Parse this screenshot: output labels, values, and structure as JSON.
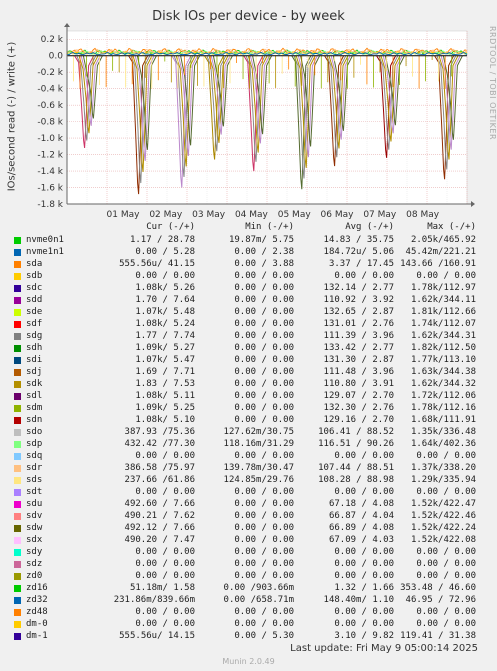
{
  "chart_data": {
    "type": "line",
    "title": "Disk IOs per device - by week",
    "ylabel": "IOs/second read (-) / write (+)",
    "ylim": [
      -1.8,
      0.3
    ],
    "yticks": [
      0.2,
      0.0,
      -0.2,
      -0.4,
      -0.6,
      -0.8,
      -1.0,
      -1.2,
      -1.4,
      -1.6,
      -1.8
    ],
    "ytick_labels": [
      "0.2 k",
      "0.0",
      "-0.2 k",
      "-0.4 k",
      "-0.6 k",
      "-0.8 k",
      "-1.0 k",
      "-1.2 k",
      "-1.4 k",
      "-1.6 k",
      "-1.8 k"
    ],
    "xticks": [
      "01 May",
      "02 May",
      "03 May",
      "04 May",
      "05 May",
      "06 May",
      "07 May",
      "08 May"
    ],
    "grid": true,
    "read_dips": [
      {
        "day": 0.55,
        "depth": -1.12,
        "color": "#cc3366"
      },
      {
        "day": 1.9,
        "depth": -1.68,
        "color": "#8f2c00"
      },
      {
        "day": 2.98,
        "depth": -1.6,
        "color": "#bb88cc"
      },
      {
        "day": 3.8,
        "depth": -1.26,
        "color": "#aa8800"
      },
      {
        "day": 4.78,
        "depth": -1.4,
        "color": "#cc3366"
      },
      {
        "day": 5.98,
        "depth": -1.62,
        "color": "#556b2f"
      },
      {
        "day": 6.8,
        "depth": -1.34,
        "color": "#8f2c00"
      },
      {
        "day": 8.1,
        "depth": -1.24,
        "color": "#990000"
      },
      {
        "day": 9.55,
        "depth": -1.5,
        "color": "#8f2c00"
      }
    ]
  },
  "columns": {
    "cur": "Cur (-/+)",
    "min": "Min (-/+)",
    "avg": "Avg (-/+)",
    "max": "Max (-/+)"
  },
  "legend": [
    {
      "name": "nvme0n1",
      "color": "#00cc00",
      "cur": "1.17 / 28.78",
      "min": "19.87m/ 5.75",
      "avg": "14.83 / 35.75",
      "max": "2.05k/465.92"
    },
    {
      "name": "nvme1n1",
      "color": "#0066b3",
      "cur": "0.00 / 5.28",
      "min": "0.00 / 2.38",
      "avg": "184.72u/ 5.06",
      "max": "45.42m/221.21"
    },
    {
      "name": "sda",
      "color": "#ff8000",
      "cur": "555.56u/ 41.15",
      "min": "0.00 / 3.88",
      "avg": "3.37 / 17.45",
      "max": "143.66 /160.91"
    },
    {
      "name": "sdb",
      "color": "#ffcc00",
      "cur": "0.00 / 0.00",
      "min": "0.00 / 0.00",
      "avg": "0.00 / 0.00",
      "max": "0.00 / 0.00"
    },
    {
      "name": "sdc",
      "color": "#330099",
      "cur": "1.08k/ 5.26",
      "min": "0.00 / 0.00",
      "avg": "132.14 / 2.77",
      "max": "1.78k/112.97"
    },
    {
      "name": "sdd",
      "color": "#990099",
      "cur": "1.70 / 7.64",
      "min": "0.00 / 0.00",
      "avg": "110.92 / 3.92",
      "max": "1.62k/344.11"
    },
    {
      "name": "sde",
      "color": "#ccff00",
      "cur": "1.07k/ 5.48",
      "min": "0.00 / 0.00",
      "avg": "132.65 / 2.87",
      "max": "1.81k/112.66"
    },
    {
      "name": "sdf",
      "color": "#ff0000",
      "cur": "1.08k/ 5.24",
      "min": "0.00 / 0.00",
      "avg": "131.01 / 2.76",
      "max": "1.74k/112.07"
    },
    {
      "name": "sdg",
      "color": "#808080",
      "cur": "1.77 / 7.74",
      "min": "0.00 / 0.00",
      "avg": "111.39 / 3.96",
      "max": "1.62k/344.31"
    },
    {
      "name": "sdh",
      "color": "#008f00",
      "cur": "1.09k/ 5.27",
      "min": "0.00 / 0.00",
      "avg": "133.42 / 2.77",
      "max": "1.82k/112.50"
    },
    {
      "name": "sdi",
      "color": "#00487d",
      "cur": "1.07k/ 5.47",
      "min": "0.00 / 0.00",
      "avg": "131.30 / 2.87",
      "max": "1.77k/113.10"
    },
    {
      "name": "sdj",
      "color": "#b35a00",
      "cur": "1.69 / 7.71",
      "min": "0.00 / 0.00",
      "avg": "111.48 / 3.96",
      "max": "1.63k/344.38"
    },
    {
      "name": "sdk",
      "color": "#b38f00",
      "cur": "1.83 / 7.53",
      "min": "0.00 / 0.00",
      "avg": "110.80 / 3.91",
      "max": "1.62k/344.32"
    },
    {
      "name": "sdl",
      "color": "#6b006b",
      "cur": "1.08k/ 5.11",
      "min": "0.00 / 0.00",
      "avg": "129.07 / 2.70",
      "max": "1.72k/112.06"
    },
    {
      "name": "sdm",
      "color": "#8fb300",
      "cur": "1.09k/ 5.25",
      "min": "0.00 / 0.00",
      "avg": "132.30 / 2.76",
      "max": "1.78k/112.16"
    },
    {
      "name": "sdn",
      "color": "#b30000",
      "cur": "1.08k/ 5.10",
      "min": "0.00 / 0.00",
      "avg": "129.16 / 2.70",
      "max": "1.68k/111.91"
    },
    {
      "name": "sdo",
      "color": "#bebebe",
      "cur": "387.93 /75.36",
      "min": "127.62m/30.75",
      "avg": "106.41 / 88.52",
      "max": "1.35k/336.48"
    },
    {
      "name": "sdp",
      "color": "#80ff80",
      "cur": "432.42 /77.30",
      "min": "118.16m/31.29",
      "avg": "116.51 / 90.26",
      "max": "1.64k/402.36"
    },
    {
      "name": "sdq",
      "color": "#80c9ff",
      "cur": "0.00 / 0.00",
      "min": "0.00 / 0.00",
      "avg": "0.00 / 0.00",
      "max": "0.00 / 0.00"
    },
    {
      "name": "sdr",
      "color": "#ffc080",
      "cur": "386.58 /75.97",
      "min": "139.78m/30.47",
      "avg": "107.44 / 88.51",
      "max": "1.37k/338.20"
    },
    {
      "name": "sds",
      "color": "#ffe680",
      "cur": "237.66 /61.86",
      "min": "124.85m/29.76",
      "avg": "108.28 / 88.98",
      "max": "1.29k/335.94"
    },
    {
      "name": "sdt",
      "color": "#aa80ff",
      "cur": "0.00 / 0.00",
      "min": "0.00 / 0.00",
      "avg": "0.00 / 0.00",
      "max": "0.00 / 0.00"
    },
    {
      "name": "sdu",
      "color": "#ee00cc",
      "cur": "492.60 / 7.66",
      "min": "0.00 / 0.00",
      "avg": "67.18 / 4.08",
      "max": "1.52k/422.47"
    },
    {
      "name": "sdv",
      "color": "#ff8080",
      "cur": "490.21 / 7.62",
      "min": "0.00 / 0.00",
      "avg": "66.87 / 4.04",
      "max": "1.52k/422.46"
    },
    {
      "name": "sdw",
      "color": "#666600",
      "cur": "492.12 / 7.66",
      "min": "0.00 / 0.00",
      "avg": "66.89 / 4.08",
      "max": "1.52k/422.24"
    },
    {
      "name": "sdx",
      "color": "#ffbfff",
      "cur": "490.20 / 7.47",
      "min": "0.00 / 0.00",
      "avg": "67.09 / 4.03",
      "max": "1.52k/422.08"
    },
    {
      "name": "sdy",
      "color": "#00ffcc",
      "cur": "0.00 / 0.00",
      "min": "0.00 / 0.00",
      "avg": "0.00 / 0.00",
      "max": "0.00 / 0.00"
    },
    {
      "name": "sdz",
      "color": "#cc6699",
      "cur": "0.00 / 0.00",
      "min": "0.00 / 0.00",
      "avg": "0.00 / 0.00",
      "max": "0.00 / 0.00"
    },
    {
      "name": "zd0",
      "color": "#999900",
      "cur": "0.00 / 0.00",
      "min": "0.00 / 0.00",
      "avg": "0.00 / 0.00",
      "max": "0.00 / 0.00"
    },
    {
      "name": "zd16",
      "color": "#00cc00",
      "cur": "51.18m/ 1.58",
      "min": "0.00 /903.66m",
      "avg": "1.32 / 1.66",
      "max": "353.48 / 46.60"
    },
    {
      "name": "zd32",
      "color": "#0066b3",
      "cur": "231.86m/839.66m",
      "min": "0.00 /658.71m",
      "avg": "148.40m/ 1.10",
      "max": "46.95 / 72.96"
    },
    {
      "name": "zd48",
      "color": "#ff8000",
      "cur": "0.00 / 0.00",
      "min": "0.00 / 0.00",
      "avg": "0.00 / 0.00",
      "max": "0.00 / 0.00"
    },
    {
      "name": "dm-0",
      "color": "#ffcc00",
      "cur": "0.00 / 0.00",
      "min": "0.00 / 0.00",
      "avg": "0.00 / 0.00",
      "max": "0.00 / 0.00"
    },
    {
      "name": "dm-1",
      "color": "#330099",
      "cur": "555.56u/ 14.15",
      "min": "0.00 / 5.30",
      "avg": "3.10 / 9.82",
      "max": "119.41 / 31.38"
    }
  ],
  "footer": {
    "last_update": "Last update: Fri May  9 05:00:14 2025",
    "munin": "Munin 2.0.49"
  },
  "watermark": "RRDTOOL / TOBI OETIKER"
}
